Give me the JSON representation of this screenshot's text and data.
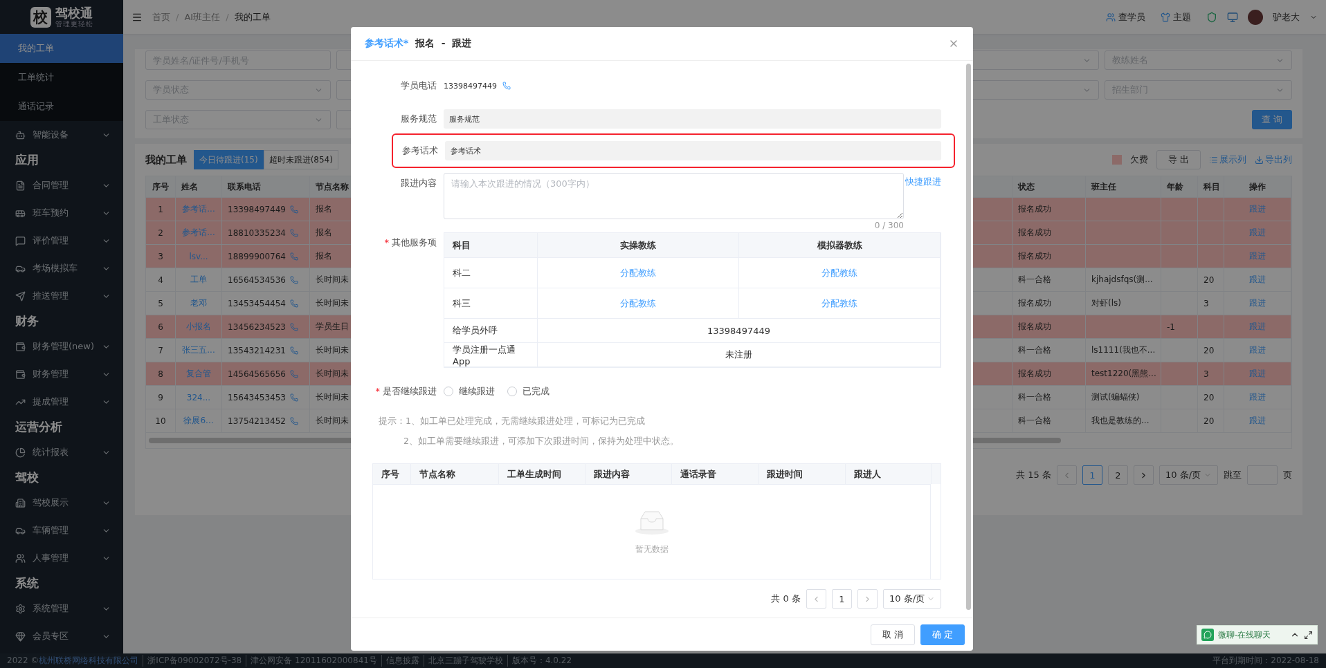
{
  "sidebar": {
    "logo": {
      "mark": "校",
      "name": "驾校通",
      "slogan": "管理更轻松"
    },
    "subitems": [
      {
        "label": "我的工单",
        "selected": true
      },
      {
        "label": "工单统计",
        "selected": false
      },
      {
        "label": "通话记录",
        "selected": false
      }
    ],
    "sections": [
      {
        "items": [
          "智能设备"
        ]
      },
      {
        "heading": "应用",
        "items": [
          "合同管理",
          "班车预约",
          "评价管理",
          "考场模拟车",
          "推送管理"
        ]
      },
      {
        "heading": "财务",
        "items": [
          "财务管理(new)",
          "财务管理",
          "提成管理"
        ]
      },
      {
        "heading": "运营分析",
        "items": [
          "统计报表"
        ]
      },
      {
        "heading": "驾校",
        "items": [
          "驾校展示",
          "车辆管理",
          "人事管理"
        ]
      },
      {
        "heading": "系统",
        "items": [
          "系统管理",
          "会员专区"
        ]
      }
    ]
  },
  "header": {
    "breadcrumb": [
      "首页",
      "AI班主任",
      "我的工单"
    ],
    "breadcrumb_separator": "/",
    "actions": [
      "查学员",
      "主题"
    ],
    "user": "驴老大"
  },
  "filters": {
    "rows": [
      {
        "left": [
          {
            "kind": "input",
            "placeholder": "学员姓名/证件号/手机号"
          },
          {
            "kind": "select"
          }
        ],
        "right": [
          {
            "kind": "select"
          },
          {
            "kind": "select",
            "placeholder": "教练姓名"
          }
        ]
      },
      {
        "left": [
          {
            "kind": "select",
            "placeholder": "学员状态"
          },
          {
            "kind": "select"
          }
        ],
        "right": [
          {
            "kind": "select"
          },
          {
            "kind": "select",
            "placeholder": "招生部门"
          }
        ]
      },
      {
        "left": [
          {
            "kind": "select",
            "placeholder": "工单状态"
          },
          {
            "kind": "select"
          }
        ],
        "right": [
          {
            "kind": "button",
            "label": "查 询"
          }
        ]
      }
    ]
  },
  "worklist": {
    "title": "我的工单",
    "tabs": [
      {
        "label": "今日待跟进(15)",
        "selected": true
      },
      {
        "label": "超时未跟进(854)",
        "selected": false
      }
    ],
    "legend": "欠费",
    "export_button": "导 出",
    "links": [
      "展示列",
      "导出列"
    ]
  },
  "table": {
    "columns": [
      "序号",
      "姓名",
      "联系电话",
      "节点名称",
      "状态",
      "班主任",
      "年龄",
      "科目",
      "操作"
    ],
    "rows": [
      {
        "no": "1",
        "name": "参考话...",
        "phone": "13398497449",
        "node": "报名",
        "status": "报名成功",
        "action": "跟进",
        "arrears": true
      },
      {
        "no": "2",
        "name": "参考话...",
        "phone": "18810335234",
        "node": "报名",
        "status": "报名成功",
        "action": "跟进",
        "arrears": true
      },
      {
        "no": "3",
        "name": "lsv...",
        "phone": "18899900764",
        "node": "报名",
        "status": "报名成功",
        "action": "跟进",
        "arrears": true
      },
      {
        "no": "4",
        "name": "工单",
        "phone": "16564534536",
        "node": "长时间未",
        "status": "科一合格",
        "teacher": "kjhajdsfqs(测...",
        "subject": "20",
        "action": "跟进",
        "arrears": false
      },
      {
        "no": "5",
        "name": "老邓",
        "phone": "13453454454",
        "node": "长时间未",
        "status": "报名成功",
        "teacher": "对虾(ls)",
        "subject": "3",
        "action": "跟进",
        "arrears": false
      },
      {
        "no": "6",
        "name": "小报名",
        "phone": "13456234523",
        "node": "学员生日",
        "status": "报名成功",
        "age": "-1",
        "action": "跟进",
        "arrears": true
      },
      {
        "no": "7",
        "name": "张三五...",
        "phone": "13543214231",
        "node": "长时间未",
        "status": "科一合格",
        "teacher": "ls1111(我也不...",
        "subject": "20",
        "action": "跟进",
        "arrears": false
      },
      {
        "no": "8",
        "name": "复合管",
        "phone": "14564565656",
        "node": "长时间未",
        "status": "报名成功",
        "teacher": "test1220(黑熊...",
        "subject": "3",
        "action": "跟进",
        "arrears": true
      },
      {
        "no": "9",
        "name": "324...",
        "phone": "15643453453",
        "node": "长时间未",
        "status": "科一合格",
        "teacher": "测试(蝙蝠侠)",
        "subject": "20",
        "action": "跟进",
        "arrears": false
      },
      {
        "no": "10",
        "name": "徐展6...",
        "phone": "13754213452",
        "node": "长时间未",
        "status": "科一合格",
        "teacher": "我也是教练的...",
        "subject": "20",
        "action": "跟进",
        "arrears": false
      }
    ]
  },
  "pagination": {
    "total": "共 15 条",
    "pages": [
      {
        "label": "1",
        "selected": true
      },
      {
        "label": "2",
        "selected": false
      }
    ],
    "page_size": "10 条/页",
    "jump_label": "跳至",
    "jump_suffix": "页"
  },
  "modal": {
    "title_highlight": "参考话术*",
    "title": "报名  -  跟进",
    "fields": [
      {
        "kind": "phone",
        "label": "学员电话",
        "value": "13398497449"
      },
      {
        "kind": "readonly",
        "label": "服务规范",
        "value": "服务规范",
        "highlighted": false
      },
      {
        "kind": "readonly",
        "label": "参考话术",
        "value": "参考话术",
        "highlighted": true
      },
      {
        "kind": "textarea",
        "label": "跟进内容",
        "placeholder": "请输入本次跟进的情况（300字内）",
        "link": "快捷跟进",
        "counter": "0 / 300"
      }
    ],
    "services": {
      "label": "其他服务项",
      "required_mark": "*",
      "columns": [
        "科目",
        "实操教练",
        "模拟器教练"
      ],
      "assign_rows": [
        {
          "subject": "科二",
          "practice": "分配教练",
          "simulator": "分配教练"
        },
        {
          "subject": "科三",
          "practice": "分配教练",
          "simulator": "分配教练"
        }
      ],
      "info_rows": [
        {
          "label": "给学员外呼",
          "value": "13398497449"
        },
        {
          "label": "学员注册一点通App",
          "value": "未注册"
        }
      ]
    },
    "continue": {
      "label": "是否继续跟进",
      "required_mark": "*",
      "options": [
        {
          "label": "继续跟进",
          "selected": false
        },
        {
          "label": "已完成",
          "selected": false
        }
      ]
    },
    "tips": [
      "提示：1、如工单已处理完成，无需继续跟进处理，可标记为已完成",
      "2、如工单需要继续跟进，可添加下次跟进时间，保持为处理中状态。"
    ],
    "history": {
      "columns": [
        "序号",
        "节点名称",
        "工单生成时间",
        "跟进内容",
        "通话录音",
        "跟进时间",
        "跟进人"
      ],
      "empty_text": "暂无数据"
    },
    "pagination": {
      "total": "共 0 条",
      "page": "1",
      "page_size": "10 条/页"
    },
    "buttons": [
      {
        "label": "取 消",
        "kind": "default"
      },
      {
        "label": "确 定",
        "kind": "primary"
      }
    ]
  },
  "footer": {
    "copyright": "2022 ©",
    "company": "杭州联桥网络科技有限公司",
    "items": [
      "浙ICP备09002072号-38",
      "津公网安备 12011602000841号",
      "信息披露",
      "北京三蹦子驾驶学校",
      "版本号：4.0.22"
    ],
    "expiry": "平台到期时间：2022-08-18"
  },
  "chat": {
    "label": "微聊-在线聊天"
  }
}
